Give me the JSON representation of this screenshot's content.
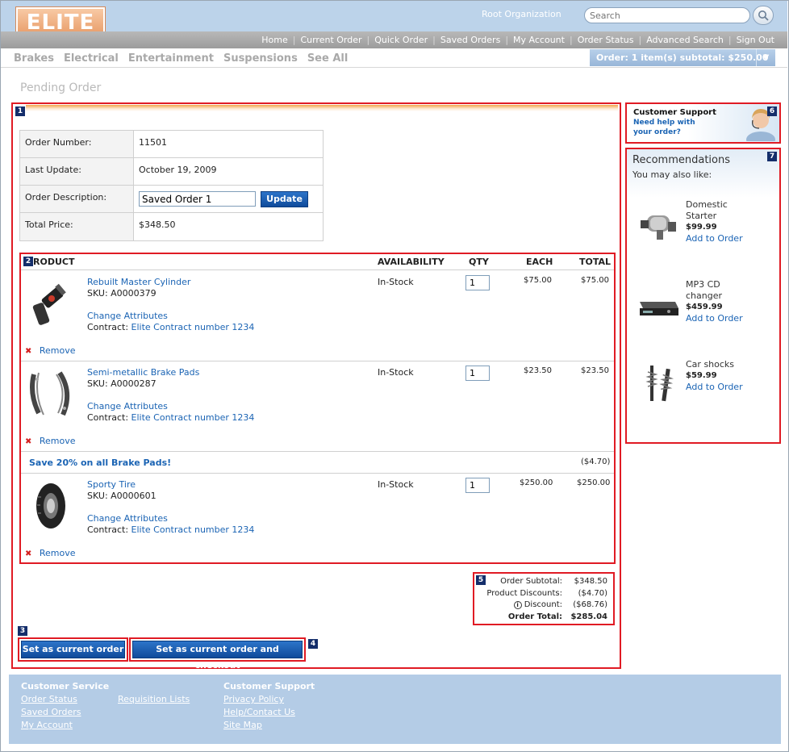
{
  "header": {
    "logo": "ELITE",
    "organization": "Root Organization",
    "search_placeholder": "Search",
    "nav": [
      "Home",
      "Current Order",
      "Quick Order",
      "Saved Orders",
      "My Account",
      "Order Status",
      "Advanced Search",
      "Sign Out"
    ],
    "categories": [
      "Brakes",
      "Electrical",
      "Entertainment",
      "Suspensions",
      "See All"
    ],
    "order_summary": "Order: 1 item(s) subtotal: $250.00"
  },
  "page_title": "Pending Order",
  "badges": [
    "1",
    "2",
    "3",
    "4",
    "5",
    "6",
    "7"
  ],
  "order_info": {
    "number_label": "Order Number:",
    "number": "11501",
    "update_label": "Last Update:",
    "update": "October 19, 2009",
    "desc_label": "Order Description:",
    "desc_value": "Saved Order 1",
    "update_button": "Update",
    "total_label": "Total Price:",
    "total": "$348.50"
  },
  "columns": {
    "product": "RODUCT",
    "availability": "AVAILABILITY",
    "qty": "QTY",
    "each": "EACH",
    "total": "TOTAL"
  },
  "items": [
    {
      "name": "Rebuilt Master Cylinder",
      "sku": "SKU: A0000379",
      "change": "Change Attributes",
      "contract_label": "Contract:",
      "contract": "Elite Contract number 1234",
      "availability": "In-Stock",
      "qty": "1",
      "each": "$75.00",
      "total": "$75.00",
      "remove": "Remove",
      "image_icon": "master-cylinder-icon"
    },
    {
      "name": "Semi-metallic Brake Pads",
      "sku": "SKU: A0000287",
      "change": "Change Attributes",
      "contract_label": "Contract:",
      "contract": "Elite Contract number 1234",
      "availability": "In-Stock",
      "qty": "1",
      "each": "$23.50",
      "total": "$23.50",
      "remove": "Remove",
      "image_icon": "brake-pads-icon"
    },
    {
      "name": "Sporty Tire",
      "sku": "SKU: A0000601",
      "change": "Change Attributes",
      "contract_label": "Contract:",
      "contract": "Elite Contract number 1234",
      "availability": "In-Stock",
      "qty": "1",
      "each": "$250.00",
      "total": "$250.00",
      "remove": "Remove",
      "image_icon": "tire-icon"
    }
  ],
  "promo": {
    "text": "Save 20% on all Brake Pads!",
    "amount": "($4.70)"
  },
  "totals": {
    "subtotal_label": "Order Subtotal:",
    "subtotal": "$348.50",
    "product_discounts_label": "Product Discounts:",
    "product_discounts": "($4.70)",
    "discount_label": "Discount:",
    "discount": "($68.76)",
    "total_label": "Order Total:",
    "total": "$285.04"
  },
  "actions": {
    "set_current": "Set as current order",
    "set_checkout": "Set as current order and checkout"
  },
  "support": {
    "title": "Customer Support",
    "line1": "Need help with",
    "line2": "your order?"
  },
  "recommendations": {
    "title": "Recommendations",
    "subtitle": "You may also like:",
    "items": [
      {
        "name_l1": "Domestic",
        "name_l2": "Starter",
        "price": "$99.99",
        "add": "Add to Order"
      },
      {
        "name_l1": "MP3 CD",
        "name_l2": "changer",
        "price": "$459.99",
        "add": "Add to Order"
      },
      {
        "name_l1": "Car shocks",
        "name_l2": "",
        "price": "$59.99",
        "add": "Add to Order"
      }
    ]
  },
  "footer": {
    "service_title": "Customer Service",
    "service_links": [
      "Order Status",
      "Saved Orders",
      "My Account"
    ],
    "requisition": "Requisition Lists",
    "support_title": "Customer Support",
    "support_links": [
      "Privacy Policy",
      "Help/Contact Us",
      "Site Map"
    ]
  },
  "colors": {
    "accent": "#1b64b4",
    "annotation": "#e01b24",
    "badge": "#142e6b",
    "header": "#bcd3ea"
  }
}
